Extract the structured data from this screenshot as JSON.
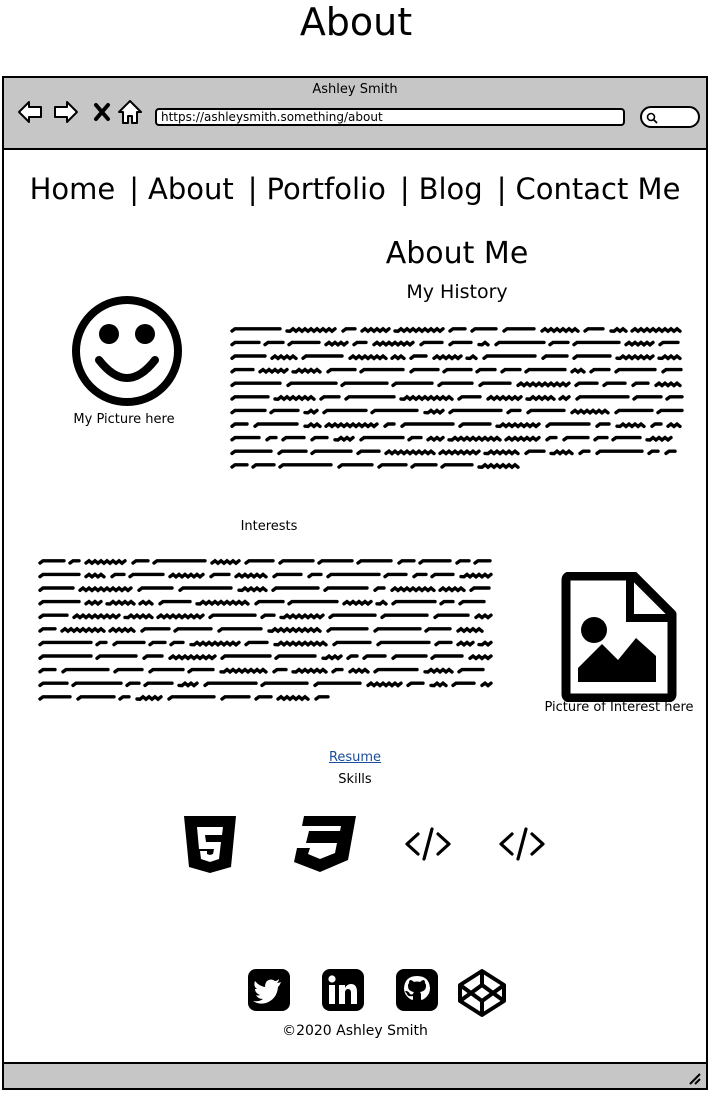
{
  "page": {
    "heading": "About"
  },
  "browser": {
    "window_title": "Ashley Smith",
    "url": "https://ashleysmith.something/about",
    "nav_icons": [
      "back-arrow-icon",
      "forward-arrow-icon",
      "stop-icon",
      "home-icon"
    ],
    "search_icon": "search-icon",
    "resize_icon": "resize-grip-icon"
  },
  "nav": {
    "items": [
      "Home",
      "About",
      "Portfolio",
      "Blog",
      "Contact Me"
    ],
    "separator": "|"
  },
  "about": {
    "title": "About Me",
    "subtitle": "My History",
    "picture_label": "My Picture here",
    "picture_icon": "smiley-face-icon"
  },
  "interests": {
    "label": "Interests",
    "picture_label": "Picture of Interest here",
    "picture_icon": "image-file-icon"
  },
  "resume": {
    "link_text": "Resume",
    "link_color": "#1a4d9c"
  },
  "skills": {
    "label": "Skills",
    "icons": [
      "html5-icon",
      "css3-icon",
      "code-icon",
      "code-icon"
    ]
  },
  "social": {
    "icons": [
      "twitter-icon",
      "linkedin-icon",
      "github-icon",
      "codepen-icon"
    ]
  },
  "footer": {
    "copyright": "©2020 Ashley Smith"
  },
  "colors": {
    "chrome_gray": "#c6c6c6",
    "ink": "#000000",
    "link_blue": "#1a4d9c"
  }
}
